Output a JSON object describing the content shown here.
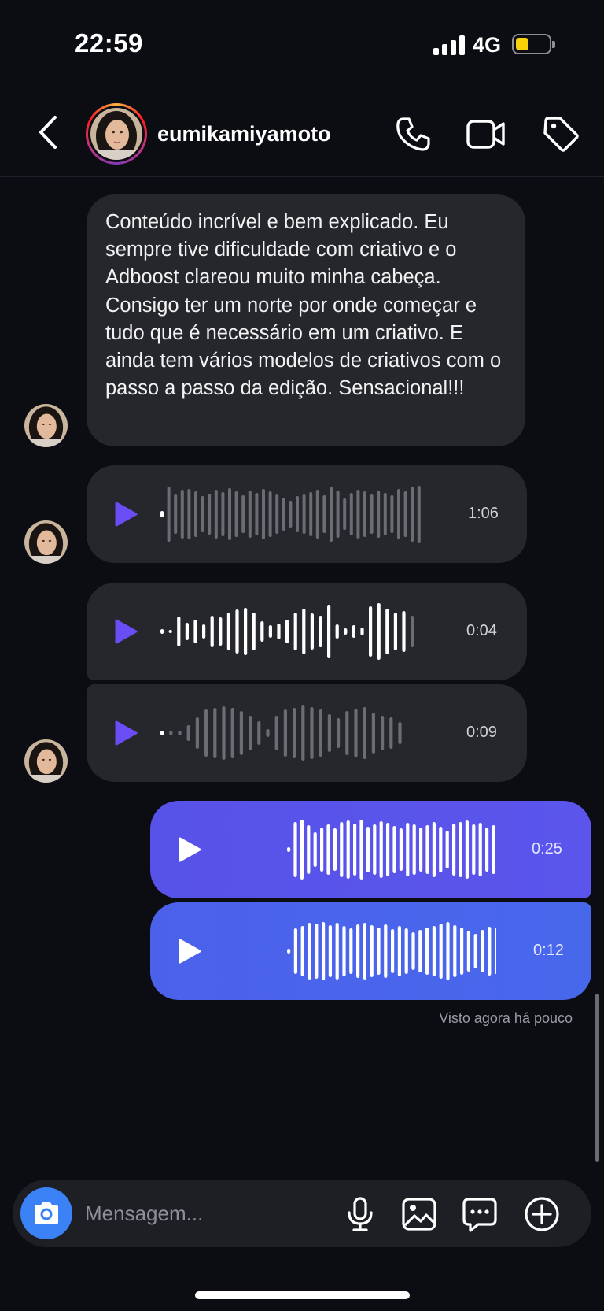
{
  "status": {
    "time": "22:59",
    "network": "4G",
    "battery_level": 0.4,
    "battery_color": "#f9d20a"
  },
  "header": {
    "username": "eumikamiyamoto",
    "icons": [
      "back-icon",
      "phone-icon",
      "video-call-icon",
      "tag-icon"
    ]
  },
  "messages": {
    "text_1": "Conteúdo incrível e bem explicado. Eu sempre tive dificuldade com criativo e o Adboost clareou muito minha cabeça. Consigo ter um norte por onde começar e tudo que é necessário em um criativo. E ainda tem vários modelos de criativos com o passo a passo da edição. Sensacional!!!",
    "voice_1": {
      "duration": "1:06",
      "played": 0.0
    },
    "voice_2": {
      "duration": "0:04",
      "played": 0.95
    },
    "voice_3": {
      "duration": "0:09",
      "played": 0.0
    },
    "voice_4": {
      "duration": "0:25"
    },
    "voice_5": {
      "duration": "0:12"
    }
  },
  "seen_label": "Visto agora há pouco",
  "composer": {
    "placeholder": "Mensagem...",
    "icons": [
      "camera-icon",
      "microphone-icon",
      "gallery-icon",
      "sticker-icon",
      "plus-icon"
    ]
  },
  "colors": {
    "accent": "#6b4df5",
    "outgoing_top": "#5b52ea",
    "outgoing_bottom": "#4667eb",
    "incoming": "#25272d"
  }
}
